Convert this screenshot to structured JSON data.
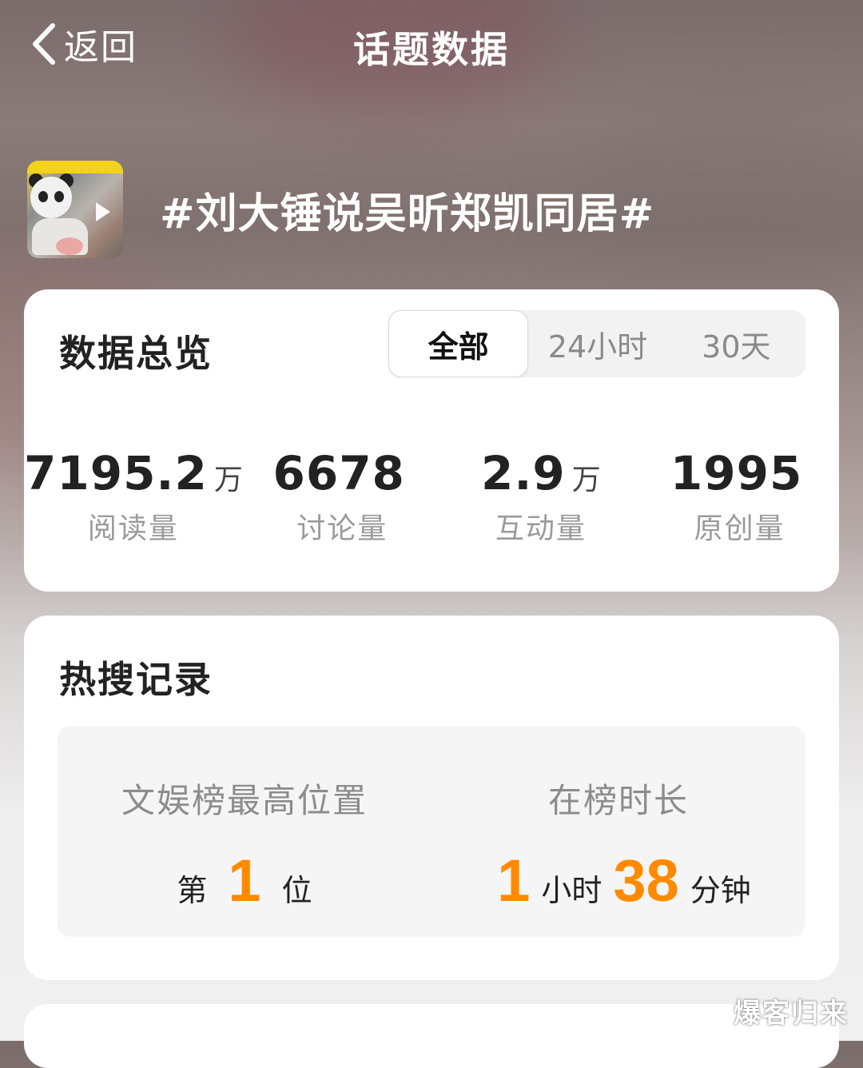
{
  "nav": {
    "back_label": "返回",
    "title": "话题数据"
  },
  "topic": {
    "title": "#刘大锤说吴昕郑凯同居#",
    "thumbnail_icon": "video-thumbnail"
  },
  "overview": {
    "title": "数据总览",
    "tabs": [
      {
        "label": "全部",
        "active": true
      },
      {
        "label": "24小时",
        "active": false
      },
      {
        "label": "30天",
        "active": false
      }
    ],
    "stats": [
      {
        "value": "7195.2",
        "unit": "万",
        "label": "阅读量"
      },
      {
        "value": "6678",
        "unit": "",
        "label": "讨论量"
      },
      {
        "value": "2.9",
        "unit": "万",
        "label": "互动量"
      },
      {
        "value": "1995",
        "unit": "",
        "label": "原创量"
      }
    ]
  },
  "hot_search": {
    "title": "热搜记录",
    "rank_label": "文娱榜最高位置",
    "rank_prefix": "第",
    "rank_value": "1",
    "rank_suffix": "位",
    "duration_label": "在榜时长",
    "duration_hours": "1",
    "hours_unit": "小时",
    "duration_minutes": "38",
    "minutes_unit": "分钟"
  },
  "watermark": "爆客归来",
  "colors": {
    "accent": "#ff8a00",
    "card_bg": "#ffffff",
    "title_text": "#222222",
    "muted_text": "#9a9a9a"
  }
}
